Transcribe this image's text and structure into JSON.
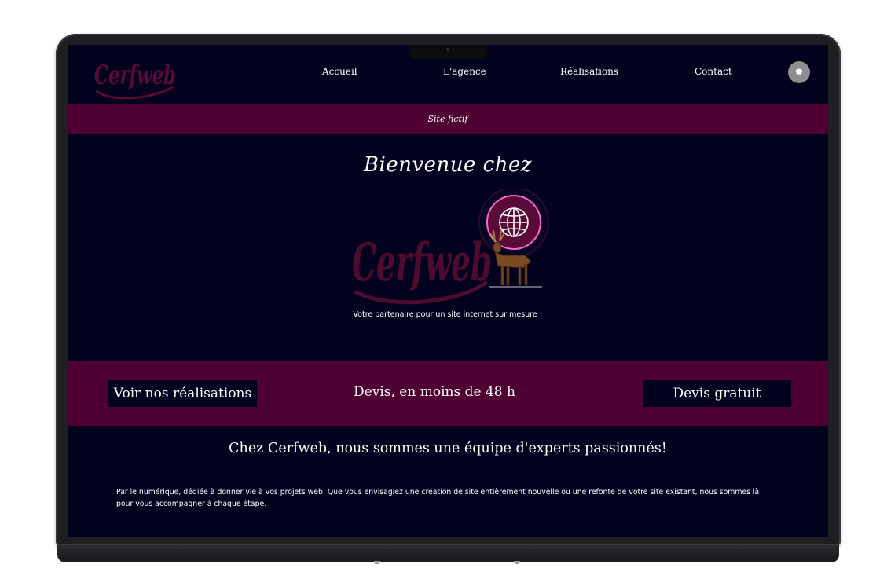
{
  "header": {
    "nav": [
      "Accueil",
      "L'agence",
      "Réalisations",
      "Contact"
    ],
    "theme_toggle_icon": "gear-icon"
  },
  "banner": {
    "text": "Site fictif"
  },
  "hero": {
    "welcome": "Bienvenue chez",
    "logo_text": "Cerfweb",
    "tagline": "Votre partenaire pour un site internet sur mesure !"
  },
  "cta": {
    "left_label": "Voir nos réalisations",
    "middle_text": "Devis, en moins de 48 h",
    "right_label": "Devis gratuit"
  },
  "intro": {
    "title": "Chez Cerfweb, nous sommes une équipe d'experts passionnés!",
    "body": "Par le numérique, dédiée à donner vie à vos projets web. Que vous envisagiez une création de site entièrement nouvelle ou une refonte de votre site existant, nous sommes là pour vous accompagner à chaque étape."
  },
  "colors": {
    "background": "#03021e",
    "accent": "#4d0031",
    "logo": "#5a0a36"
  }
}
